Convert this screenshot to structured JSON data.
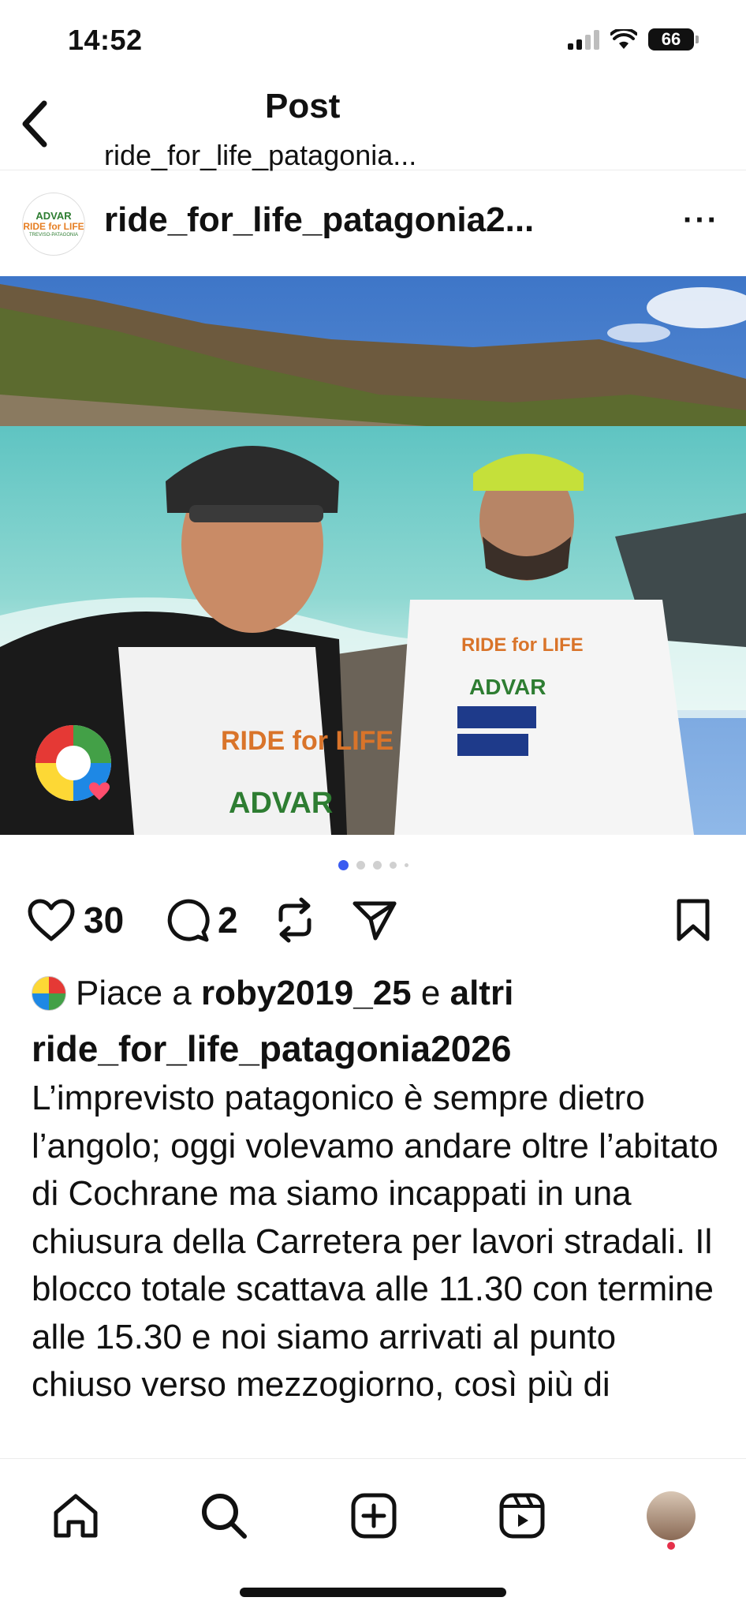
{
  "status_bar": {
    "time": "14:52",
    "battery": "66"
  },
  "header": {
    "title": "Post",
    "subtitle": "ride_for_life_patagonia..."
  },
  "post": {
    "username": "ride_for_life_patagonia2...",
    "avatar_lines": [
      "ADVAR",
      "RIDE for LIFE",
      "TREVISO-PATAGONIA"
    ],
    "image_description_icons": [
      "photo"
    ],
    "carousel": {
      "total": 5,
      "active_index": 0
    }
  },
  "actions": {
    "likes": "30",
    "comments": "2"
  },
  "caption": {
    "likes_prefix": "Piace a",
    "liked_by": "roby2019_25",
    "and": "e",
    "others": "altri",
    "author": "ride_for_life_patagonia2026",
    "text": "L’imprevisto patagonico è sempre dietro l’angolo; oggi volevamo andare oltre l’abitato di Cochrane ma siamo incappati in una chiusura della Carretera per lavori stradali. Il blocco totale scattava alle 11.30 con termine alle 15.30 e noi siamo arrivati al punto chiuso verso mezzogiorno, così più di"
  },
  "tab_bar": {
    "items": [
      "home-icon",
      "search-icon",
      "create-icon",
      "reels-icon",
      "profile-avatar"
    ]
  },
  "colors": {
    "accent": "#3a5bf0",
    "notification": "#e5304a"
  }
}
